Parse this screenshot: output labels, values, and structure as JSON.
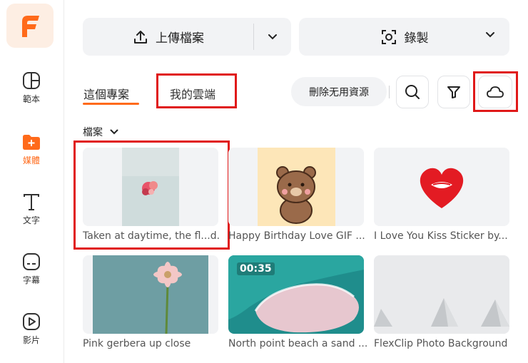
{
  "sidebar": {
    "logo_letter": "F",
    "items": [
      {
        "label": "範本",
        "icon": "template-icon"
      },
      {
        "label": "媒體",
        "icon": "media-folder-icon",
        "active": true
      },
      {
        "label": "文字",
        "icon": "text-icon"
      },
      {
        "label": "字幕",
        "icon": "subtitle-icon"
      },
      {
        "label": "影片",
        "icon": "video-icon"
      }
    ]
  },
  "toolbar": {
    "upload_label": "上傳檔案",
    "record_label": "錄製"
  },
  "tabs": {
    "project": "這個專案",
    "cloud": "我的雲端"
  },
  "actions": {
    "cleanup_label": "刪除无用資源"
  },
  "folder": {
    "label": "檔案"
  },
  "media": [
    {
      "caption": "Taken at daytime, the fl...d.",
      "duration": ""
    },
    {
      "caption": "Happy Birthday Love GIF ...",
      "duration": ""
    },
    {
      "caption": "I Love You Kiss Sticker by...",
      "duration": ""
    },
    {
      "caption": "Pink gerbera up close",
      "duration": ""
    },
    {
      "caption": "North point beach a sand ...",
      "duration": "00:35"
    },
    {
      "caption": "FlexClip Photo Background",
      "duration": ""
    }
  ],
  "colors": {
    "accent": "#ff6a1a",
    "highlight": "#e01919",
    "button_bg": "#f2f3f5"
  }
}
